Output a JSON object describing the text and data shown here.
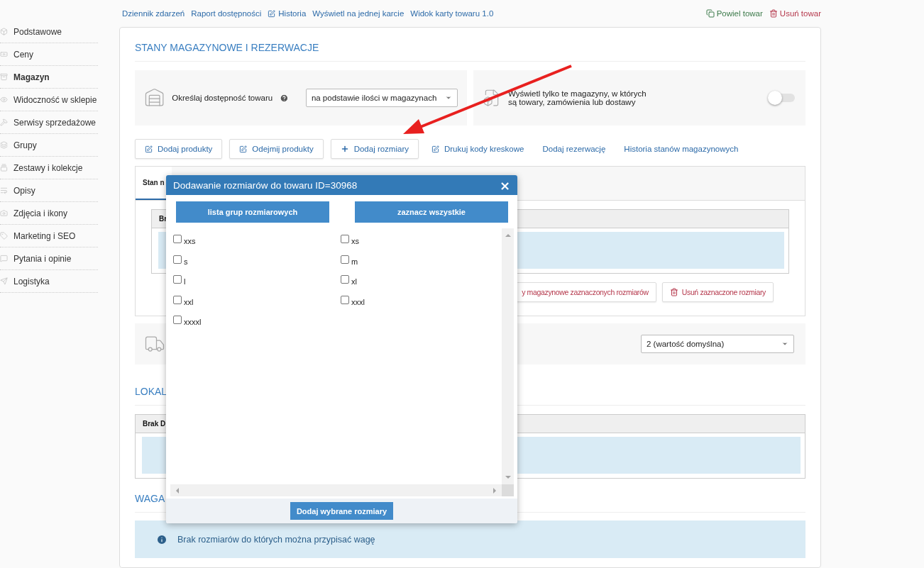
{
  "top_links": [
    {
      "label": "Dziennik zdarzeń",
      "kind": "plain"
    },
    {
      "label": "Raport dostępności",
      "kind": "plain"
    },
    {
      "label": "Historia",
      "kind": "edit"
    },
    {
      "label": "Wyświetl na jednej karcie",
      "kind": "plain"
    },
    {
      "label": "Widok karty towaru 1.0",
      "kind": "plain"
    }
  ],
  "actions": [
    {
      "label": "Powiel towar",
      "kind": "copy"
    },
    {
      "label": "Usuń towar",
      "kind": "delete"
    }
  ],
  "sidebar": {
    "items": [
      {
        "label": "Podstawowe",
        "selected": false
      },
      {
        "label": "Ceny",
        "selected": false
      },
      {
        "label": "Magazyn",
        "selected": true
      },
      {
        "label": "Widoczność w sklepie",
        "selected": false
      },
      {
        "label": "Serwisy sprzedażowe",
        "selected": false
      },
      {
        "label": "Grupy",
        "selected": false
      },
      {
        "label": "Zestawy i kolekcje",
        "selected": false
      },
      {
        "label": "Opisy",
        "selected": false
      },
      {
        "label": "Zdjęcia i ikony",
        "selected": false
      },
      {
        "label": "Marketing i SEO",
        "selected": false
      },
      {
        "label": "Pytania i opinie",
        "selected": false
      },
      {
        "label": "Logistyka",
        "selected": false
      }
    ]
  },
  "stock": {
    "title": "STANY MAGAZYNOWE I REZERWACJE",
    "availability": {
      "label": "Określaj dostępność towaru",
      "value": "na podstawie ilości w magazynach"
    },
    "filter_toggle": {
      "label": "Wyświetl tylko te magazyny, w których są towary, zamówienia lub dostawy",
      "on": false
    },
    "actions": [
      {
        "label": "Dodaj produkty",
        "kind": "edit"
      },
      {
        "label": "Odejmij produkty",
        "kind": "edit"
      },
      {
        "label": "Dodaj rozmiary",
        "kind": "add"
      },
      {
        "label": "Drukuj kody kreskowe",
        "kind": "tool"
      },
      {
        "label": "Dodaj rezerwację",
        "kind": "link"
      },
      {
        "label": "Historia stanów magazynowych",
        "kind": "link"
      }
    ],
    "tabs": [
      {
        "label": "Stan n",
        "selected": true
      }
    ],
    "table_header": "Br",
    "size_actions": [
      {
        "label": "y magazynowe zaznaczonych rozmiarów",
        "kind": "partial"
      },
      {
        "label": "Usuń zaznaczone rozmiary",
        "kind": "delete"
      }
    ],
    "delivery_select": {
      "value": "2 (wartość domyślna)"
    }
  },
  "location": {
    "title": "LOKAL",
    "table_header": "Brak D"
  },
  "weight": {
    "title": "WAGA",
    "info": "Brak rozmiarów do których można przypisać wagę"
  },
  "dialog": {
    "title": "Dodawanie rozmiarów do towaru ID=30968",
    "close": "×",
    "buttons": [
      "lista grup rozmiarowych",
      "zaznacz wszystkie"
    ],
    "sizes": [
      {
        "label": "xxs",
        "checked": false
      },
      {
        "label": "xs",
        "checked": false
      },
      {
        "label": "s",
        "checked": false
      },
      {
        "label": "m",
        "checked": false
      },
      {
        "label": "l",
        "checked": false
      },
      {
        "label": "xl",
        "checked": false
      },
      {
        "label": "xxl",
        "checked": false
      },
      {
        "label": "xxxl",
        "checked": false
      },
      {
        "label": "xxxxl",
        "checked": false
      }
    ],
    "submit": "Dodaj wybrane rozmiary"
  }
}
